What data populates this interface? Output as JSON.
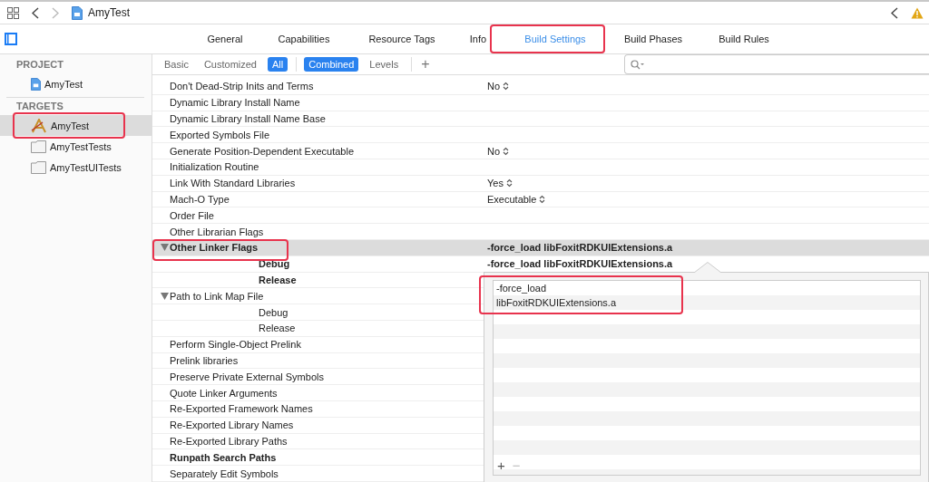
{
  "toolbar": {
    "title": "AmyTest"
  },
  "tabs": [
    {
      "label": "General",
      "selected": false
    },
    {
      "label": "Capabilities",
      "selected": false
    },
    {
      "label": "Resource Tags",
      "selected": false
    },
    {
      "label": "Info",
      "selected": false
    },
    {
      "label": "Build Settings",
      "selected": true
    },
    {
      "label": "Build Phases",
      "selected": false
    },
    {
      "label": "Build Rules",
      "selected": false
    }
  ],
  "sidebar": {
    "sections": [
      {
        "header": "PROJECT",
        "items": [
          {
            "label": "AmyTest",
            "kind": "project",
            "selected": false
          }
        ]
      },
      {
        "header": "TARGETS",
        "items": [
          {
            "label": "AmyTest",
            "kind": "app",
            "selected": true
          },
          {
            "label": "AmyTestTests",
            "kind": "bundle",
            "selected": false
          },
          {
            "label": "AmyTestUITests",
            "kind": "bundle",
            "selected": false
          }
        ]
      }
    ]
  },
  "filters": {
    "scope": [
      {
        "label": "Basic",
        "selected": false
      },
      {
        "label": "Customized",
        "selected": false
      },
      {
        "label": "All",
        "selected": true
      }
    ],
    "view": [
      {
        "label": "Combined",
        "selected": true
      },
      {
        "label": "Levels",
        "selected": false
      }
    ],
    "add": "+"
  },
  "settings": [
    {
      "name": "Don't Dead-Strip Inits and Terms",
      "value": "No",
      "stepper": true
    },
    {
      "name": "Dynamic Library Install Name"
    },
    {
      "name": "Dynamic Library Install Name Base"
    },
    {
      "name": "Exported Symbols File"
    },
    {
      "name": "Generate Position-Dependent Executable",
      "value": "No",
      "stepper": true
    },
    {
      "name": "Initialization Routine"
    },
    {
      "name": "Link With Standard Libraries",
      "value": "Yes",
      "stepper": true
    },
    {
      "name": "Mach-O Type",
      "value": "Executable",
      "stepper": true
    },
    {
      "name": "Order File"
    },
    {
      "name": "Other Librarian Flags"
    },
    {
      "name": "Other Linker Flags",
      "value": "-force_load libFoxitRDKUIExtensions.a",
      "bold": true,
      "selected": true,
      "expanded": true,
      "children": [
        {
          "name": "Debug",
          "value": "-force_load libFoxitRDKUIExtensions.a",
          "bold": true
        },
        {
          "name": "Release",
          "bold": true
        }
      ]
    },
    {
      "name": "Path to Link Map File",
      "expanded": true,
      "children": [
        {
          "name": "Debug"
        },
        {
          "name": "Release"
        }
      ]
    },
    {
      "name": "Perform Single-Object Prelink"
    },
    {
      "name": "Prelink libraries"
    },
    {
      "name": "Preserve Private External Symbols"
    },
    {
      "name": "Quote Linker Arguments"
    },
    {
      "name": "Re-Exported Framework Names"
    },
    {
      "name": "Re-Exported Library Names"
    },
    {
      "name": "Re-Exported Library Paths"
    },
    {
      "name": "Runpath Search Paths",
      "bold": true
    },
    {
      "name": "Separately Edit Symbols"
    }
  ],
  "popover": {
    "items": [
      "-force_load",
      "libFoxitRDKUIExtensions.a"
    ],
    "add": "+",
    "remove": "−"
  }
}
